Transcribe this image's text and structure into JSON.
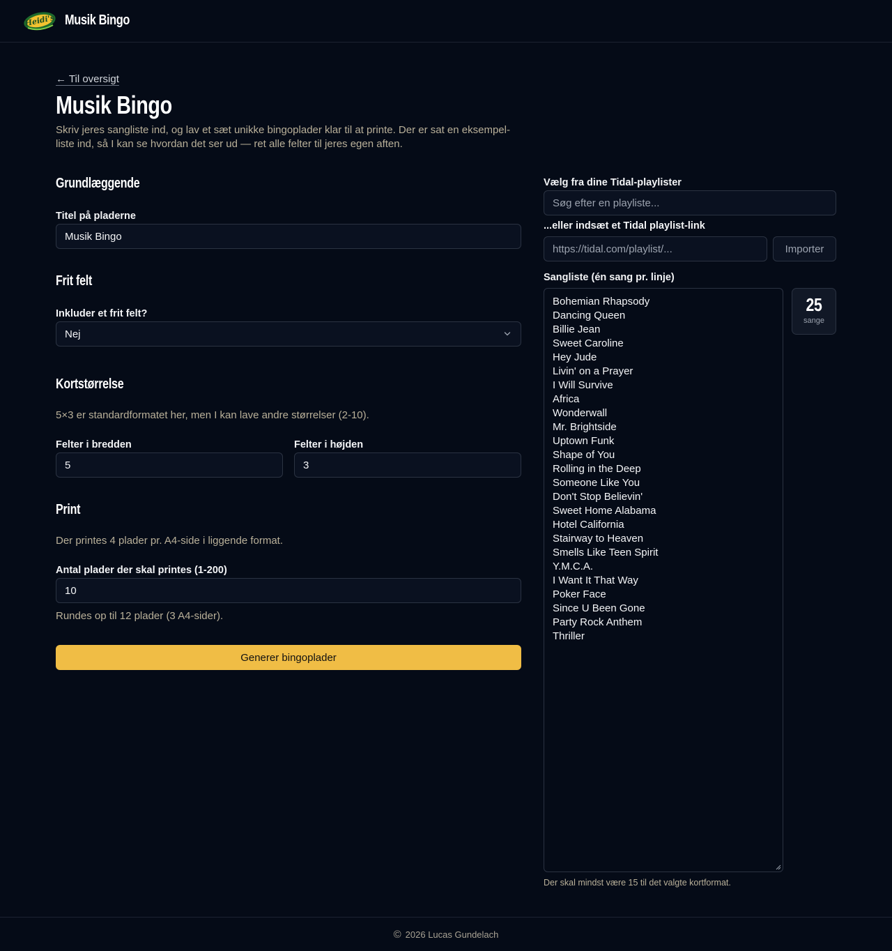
{
  "header": {
    "logo_text": "Heidi's",
    "brand": "Musik Bingo"
  },
  "intro": {
    "back_link": "← Til oversigt",
    "title": "Musik Bingo",
    "description": "Skriv jeres sangliste ind, og lav et sæt unikke bingoplader klar til at printe. Der er sat en eksempel-liste ind, så I kan se hvordan det ser ud — ret alle felter til jeres egen aften."
  },
  "basics": {
    "section_title": "Grundlæggende",
    "title_label": "Titel på pladerne",
    "title_value": "Musik Bingo"
  },
  "free_field": {
    "section_title": "Frit felt",
    "label": "Inkluder et frit felt?",
    "selected": "Nej"
  },
  "card_size": {
    "section_title": "Kortstørrelse",
    "hint": "5×3 er standardformatet her, men I kan lave andre størrelser (2-10).",
    "width_label": "Felter i bredden",
    "width_value": "5",
    "height_label": "Felter i højden",
    "height_value": "3"
  },
  "print": {
    "section_title": "Print",
    "hint": "Der printes 4 plader pr. A4-side i liggende format.",
    "count_label": "Antal plader der skal printes (1-200)",
    "count_value": "10",
    "rounding_note": "Rundes op til 12 plader (3 A4-sider).",
    "generate_label": "Generer bingoplader"
  },
  "tidal": {
    "choose_label": "Vælg fra dine Tidal-playlister",
    "search_placeholder": "Søg efter en playliste...",
    "link_label": "...eller indsæt et Tidal playlist-link",
    "link_placeholder": "https://tidal.com/playlist/...",
    "import_label": "Importer"
  },
  "songlist": {
    "label": "Sangliste (én sang pr. linje)",
    "songs": [
      "Bohemian Rhapsody",
      "Dancing Queen",
      "Billie Jean",
      "Sweet Caroline",
      "Hey Jude",
      "Livin' on a Prayer",
      "I Will Survive",
      "Africa",
      "Wonderwall",
      "Mr. Brightside",
      "Uptown Funk",
      "Shape of You",
      "Rolling in the Deep",
      "Someone Like You",
      "Don't Stop Believin'",
      "Sweet Home Alabama",
      "Hotel California",
      "Stairway to Heaven",
      "Smells Like Teen Spirit",
      "Y.M.C.A.",
      "I Want It That Way",
      "Poker Face",
      "Since U Been Gone",
      "Party Rock Anthem",
      "Thriller"
    ],
    "count": "25",
    "count_unit": "sange",
    "minimum_note": "Der skal mindst være 15 til det valgte kortformat."
  },
  "footer": {
    "copyright_symbol": "©",
    "text": "2026 Lucas Gundelach"
  },
  "colors": {
    "background": "#050b17",
    "accent": "#f0bd45",
    "muted_text": "#b9b099",
    "border": "#2b3342"
  }
}
